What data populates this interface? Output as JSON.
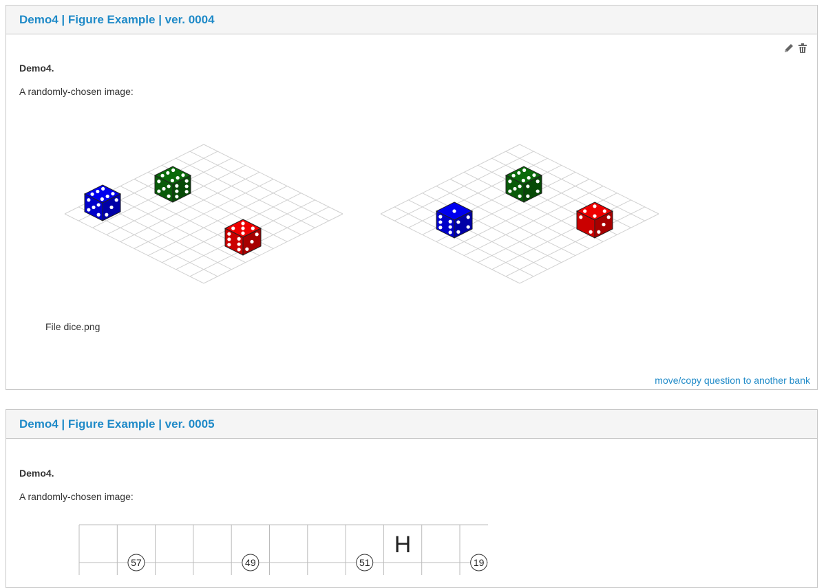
{
  "questions": [
    {
      "title": "Demo4 | Figure Example | ver. 0004",
      "name": "Demo4.",
      "text": "A randomly-chosen image:",
      "file_label": "File dice.png",
      "move_link": "move/copy question to another bank",
      "toolbar": {
        "edit_icon": "pencil-icon",
        "delete_icon": "trash-icon"
      },
      "image": {
        "type": "dice-grid",
        "die_colors": [
          "#0000ee",
          "#0a6b0a",
          "#ee0000"
        ]
      }
    },
    {
      "title": "Demo4 | Figure Example | ver. 0005",
      "name": "Demo4.",
      "text": "A randomly-chosen image:",
      "image": {
        "type": "number-grid",
        "cell_letter": "H",
        "circled_numbers": [
          "57",
          "49",
          "51",
          "19"
        ]
      }
    }
  ]
}
